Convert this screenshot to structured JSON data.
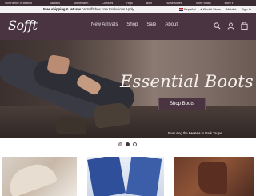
{
  "brand_bar": {
    "family": "Our Family of Brands",
    "brands": [
      "Sandles",
      "Mothertarm",
      "Comsies",
      "Hlgo",
      "Born",
      "Nurse Mates",
      "Sperr Boats",
      "More"
    ]
  },
  "ship_bar": {
    "text_bold": "Free shipping & returns",
    "text_rest": " on Sofftshoe.com Exclusions Apply",
    "language": "Español",
    "find_store": "Find A Store",
    "wishlist": "Wishlist",
    "sign_in": "Sign In"
  },
  "header": {
    "logo": "Sofft",
    "nav": [
      "New Arrivals",
      "Shop",
      "Sale",
      "About"
    ],
    "icons": [
      "search-icon",
      "user-icon",
      "bag-icon"
    ]
  },
  "hero": {
    "title": "Essential Boots",
    "button": "Shop Boots",
    "caption_prefix": "Featuring the ",
    "caption_bold": "Leanna",
    "caption_suffix": " in Dark Taupe"
  },
  "carousel": {
    "slides": 3,
    "active": 1
  },
  "colors": {
    "header": "#4b3441",
    "brand_bar": "#3a2b33",
    "ship_bar": "#f4f1f2"
  }
}
